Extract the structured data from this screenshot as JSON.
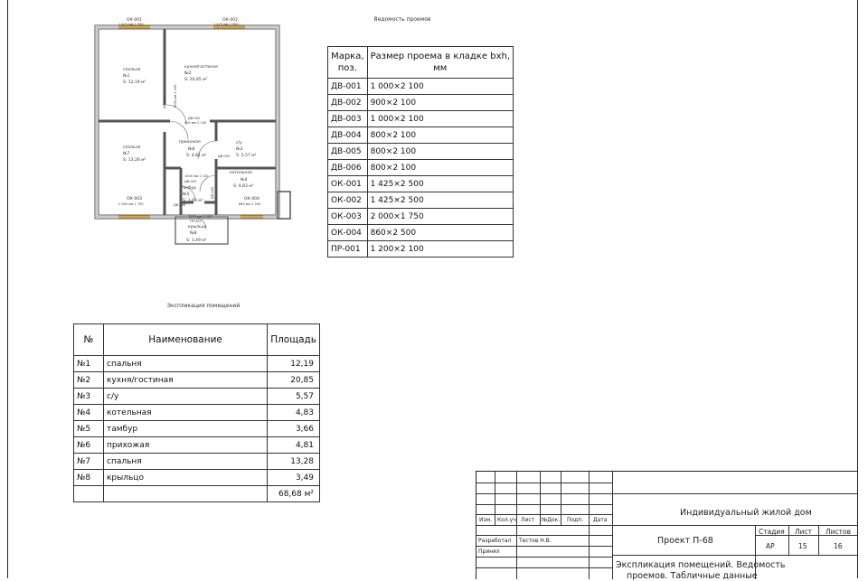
{
  "floor_plan": {
    "windows": [
      {
        "mark": "ОК-001",
        "size": "1 425 мм 2 500"
      },
      {
        "mark": "ОК-002",
        "size": "1 425 мм 2 500"
      },
      {
        "mark": "ОК-003",
        "size": "2 000 мм 1 750"
      },
      {
        "mark": "ОК-004",
        "size": "860 мм 2 500"
      }
    ],
    "doors": [
      {
        "mark": "ДВ-001",
        "size": "1000 мм 2 100"
      },
      {
        "mark": "ДВ-002",
        "size": "900 мм 2 100"
      },
      {
        "mark": "ДВ-003",
        "size": "1000 мм 2 100"
      },
      {
        "mark": "ДВ-004",
        "size": "800 мм 2 100"
      },
      {
        "mark": "ДВ-005",
        "size": "800 мм 2 100"
      },
      {
        "mark": "ДВ-006",
        "size": "800 мм 2 100"
      },
      {
        "mark": "ПР-001",
        "size": "1200 мм 2 100"
      }
    ],
    "rooms": [
      {
        "name": "спальня",
        "num": "№1",
        "area": "S: 12,19 м²"
      },
      {
        "name": "кухня/гостиная",
        "num": "№2",
        "area": "S: 20,85 м²"
      },
      {
        "name": "с/у",
        "num": "№3",
        "area": "S: 5,57 м²"
      },
      {
        "name": "котельная",
        "num": "№4",
        "area": "S: 4,83 м²"
      },
      {
        "name": "тамбур",
        "num": "№5",
        "area": "S: 3,66 м²"
      },
      {
        "name": "прихожая",
        "num": "№6",
        "area": "S: 4,81 м²"
      },
      {
        "name": "спальня",
        "num": "№7",
        "area": "S: 13,28 м²"
      },
      {
        "name": "крыльцо",
        "num": "№8",
        "area": "S: 3,49 м²"
      }
    ]
  },
  "schedule": {
    "title": "Ведомость проемов",
    "header_mark_line1": "Марка,",
    "header_mark_line2": "поз.",
    "header_size_line1": "Размер проема в кладке bxh,",
    "header_size_line2": "мм",
    "rows": [
      {
        "mark": "ДВ-001",
        "size": "1 000×2 100"
      },
      {
        "mark": "ДВ-002",
        "size": "900×2 100"
      },
      {
        "mark": "ДВ-003",
        "size": "1 000×2 100"
      },
      {
        "mark": "ДВ-004",
        "size": "800×2 100"
      },
      {
        "mark": "ДВ-005",
        "size": "800×2 100"
      },
      {
        "mark": "ДВ-006",
        "size": "800×2 100"
      },
      {
        "mark": "ОК-001",
        "size": "1 425×2 500"
      },
      {
        "mark": "ОК-002",
        "size": "1 425×2 500"
      },
      {
        "mark": "ОК-003",
        "size": "2 000×1 750"
      },
      {
        "mark": "ОК-004",
        "size": "860×2 500"
      },
      {
        "mark": "ПР-001",
        "size": "1 200×2 100"
      }
    ]
  },
  "explication": {
    "title": "Экспликация помещений",
    "header_num": "№",
    "header_name": "Наименование",
    "header_area": "Площадь",
    "rows": [
      {
        "num": "№1",
        "name": "спальня",
        "area": "12,19"
      },
      {
        "num": "№2",
        "name": "кухня/гостиная",
        "area": "20,85"
      },
      {
        "num": "№3",
        "name": "с/у",
        "area": "5,57"
      },
      {
        "num": "№4",
        "name": "котельная",
        "area": "4,83"
      },
      {
        "num": "№5",
        "name": "тамбур",
        "area": "3,66"
      },
      {
        "num": "№6",
        "name": "прихожая",
        "area": "4,81"
      },
      {
        "num": "№7",
        "name": "спальня",
        "area": "13,28"
      },
      {
        "num": "№8",
        "name": "крыльцо",
        "area": "3,49"
      }
    ],
    "total": "68,68 м²"
  },
  "stamp": {
    "col_izm": "Изм.",
    "col_kol": "Кол.уч.",
    "col_list": "Лист",
    "col_ndok": "№Док.",
    "col_podp": "Подп.",
    "col_data": "Дата",
    "razrabotal": "Разработал",
    "razrabotal_name": "Тестов Н.В.",
    "prinyal": "Принял",
    "object": "Индивидуальный жилой дом",
    "project": "Проект П-68",
    "stadiya_label": "Стадия",
    "list_label": "Лист",
    "listov_label": "Листов",
    "stadiya": "АР",
    "list": "15",
    "listov": "16",
    "sheet_title_line1": "Экспликация помещений. Ведомость",
    "sheet_title_line2": "проемов. Табличные данные"
  }
}
